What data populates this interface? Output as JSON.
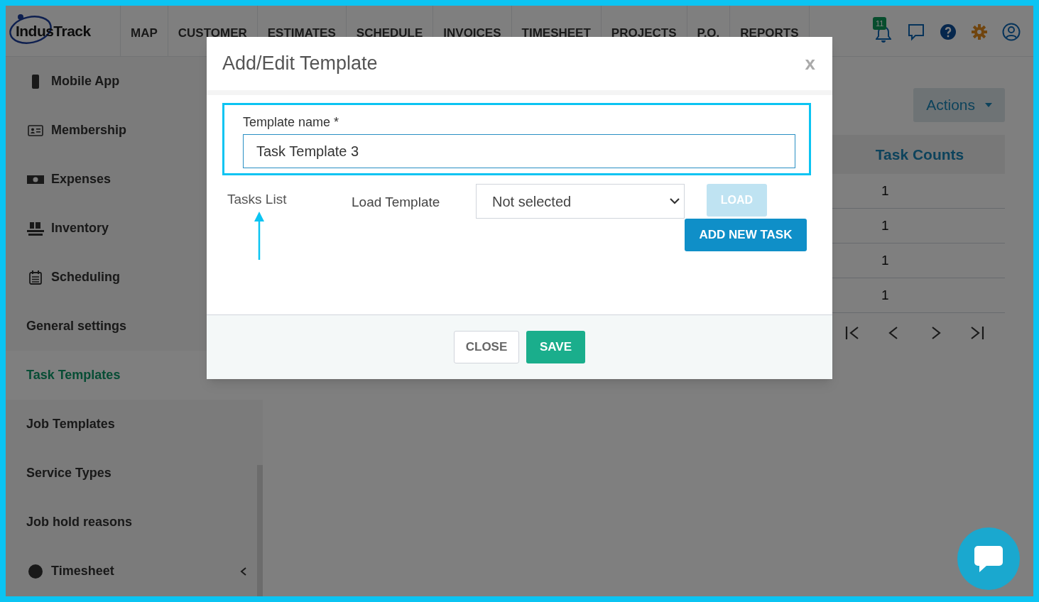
{
  "nav": {
    "logo": "IndusTrack",
    "menu": [
      "MAP",
      "CUSTOMER",
      "ESTIMATES",
      "SCHEDULE",
      "INVOICES",
      "TIMESHEET",
      "PROJECTS",
      "P.O.",
      "REPORTS"
    ],
    "notification_count": "11"
  },
  "sidebar": {
    "items": [
      {
        "label": "Mobile App",
        "kind": "icon",
        "selected": false
      },
      {
        "label": "Membership",
        "kind": "icon",
        "selected": false
      },
      {
        "label": "Expenses",
        "kind": "icon",
        "selected": false
      },
      {
        "label": "Inventory",
        "kind": "icon",
        "selected": false
      },
      {
        "label": "Scheduling",
        "kind": "icon",
        "selected": false
      },
      {
        "label": "General settings",
        "kind": "plain",
        "selected": false
      },
      {
        "label": "Task Templates",
        "kind": "plain",
        "selected": true
      },
      {
        "label": "Job Templates",
        "kind": "plain",
        "selected": false
      },
      {
        "label": "Service Types",
        "kind": "plain",
        "selected": false
      },
      {
        "label": "Job hold reasons",
        "kind": "plain",
        "selected": false
      },
      {
        "label": "Timesheet",
        "kind": "group",
        "selected": false
      }
    ]
  },
  "main": {
    "actions_button": "Actions",
    "table": {
      "columns": [
        "Task Counts"
      ],
      "rows": [
        [
          "1"
        ],
        [
          "1"
        ],
        [
          "1"
        ],
        [
          "1"
        ]
      ]
    }
  },
  "modal": {
    "title": "Add/Edit Template",
    "close": "x",
    "template_name": {
      "label": "Template name *",
      "value": "Task Template 3"
    },
    "tasks_list_label": "Tasks List",
    "load_template": {
      "label": "Load Template",
      "value": "Not selected"
    },
    "load_button": {
      "label": "LOAD",
      "disabled": true
    },
    "add_task_button": "ADD NEW TASK",
    "footer_buttons": [
      {
        "label": "CLOSE",
        "kind": "secondary"
      },
      {
        "label": "SAVE",
        "kind": "primary"
      }
    ]
  }
}
